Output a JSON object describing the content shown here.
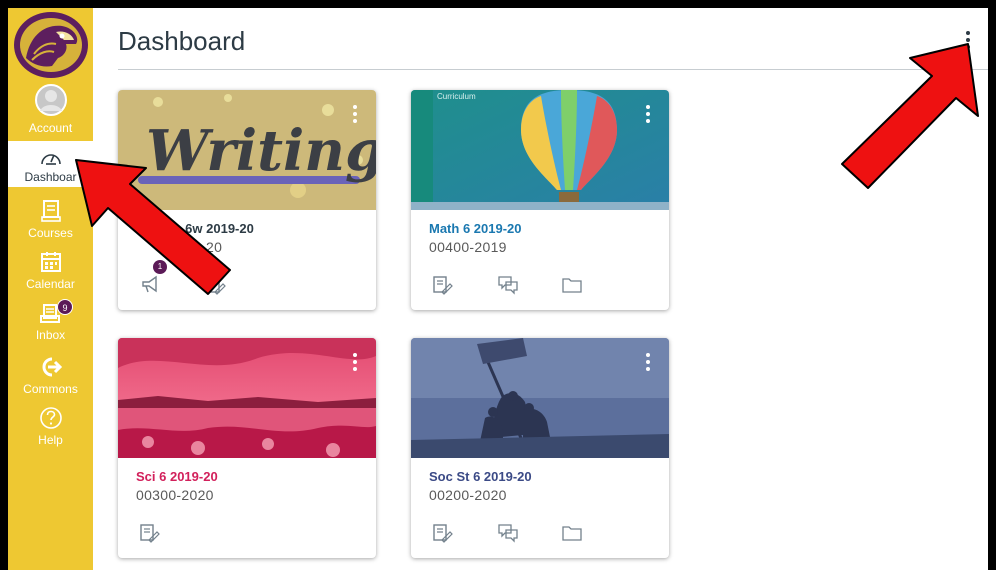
{
  "sidebar": {
    "account_label": "Account",
    "dashboard_label": "Dashboar",
    "courses_label": "Courses",
    "calendar_label": "Calendar",
    "inbox_label": "Inbox",
    "inbox_count": "9",
    "commons_label": "Commons",
    "help_label": "Help"
  },
  "header": {
    "title": "Dashboard"
  },
  "cards": [
    {
      "title": "ts 6w 2019-20",
      "term": "20",
      "hero_text": "Writing",
      "title_color": "#2d3b45",
      "announcement_count": "1"
    },
    {
      "title": "Math 6 2019-20",
      "term": "00400-2019",
      "hero_text": "Curriculum",
      "title_color": "#1a78b0"
    },
    {
      "title": "Sci 6 2019-20",
      "term": "00300-2020",
      "title_color": "#d2205b"
    },
    {
      "title": "Soc St 6 2019-20",
      "term": "00200-2020",
      "title_color": "#3b4a86"
    }
  ],
  "colors": {
    "sidebar": "#eec832",
    "arrow": "#ee1111"
  }
}
